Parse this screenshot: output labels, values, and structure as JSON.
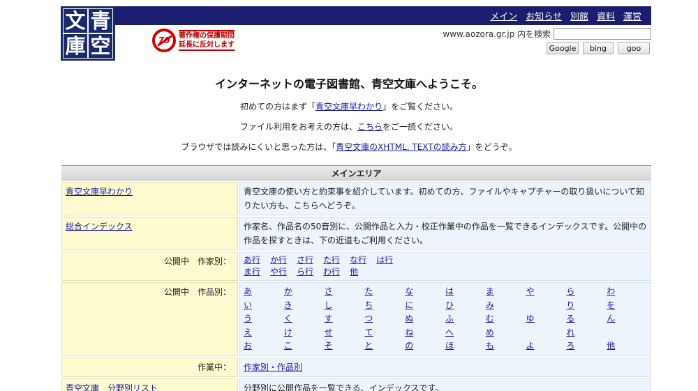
{
  "logo": {
    "chars": [
      "文",
      "青",
      "庫",
      "空"
    ]
  },
  "nav": [
    "メイン",
    "お知らせ",
    "別館",
    "資料",
    "運営"
  ],
  "campaign": {
    "badge": "70",
    "line1": "著作権の保護期間",
    "line2": "延長に反対します"
  },
  "search": {
    "label": "www.aozora.gr.jp 内を検索",
    "value": "",
    "buttons": [
      "Google",
      "bing",
      "goo"
    ]
  },
  "headline": "インターネットの電子図書館、青空文庫へようこそ。",
  "intro": [
    {
      "pre": "初めての方はまず「",
      "link": "青空文庫早わかり",
      "post": "」をご覧ください。"
    },
    {
      "pre": "ファイル利用をお考えの方は、",
      "link": "こちら",
      "post": "をご一読ください。"
    },
    {
      "pre": "ブラウザでは読みにくいと思った方は、「",
      "link": "青空文庫のXHTML, TEXTの読み方",
      "post": "」をどうぞ。"
    }
  ],
  "main": {
    "header": "メインエリア",
    "quick": {
      "link": "青空文庫早わかり",
      "desc": "青空文庫の使い方と約束事を紹介しています。初めての方、ファイルやキャプチャーの取り扱いについて知りたい方も、こちらへどうぞ。"
    },
    "index": {
      "link": "総合インデックス",
      "desc": "作家名、作品名の50音別に、公開作品と入力・校正作業中の作品を一覧できるインデックスです。公開中の作品を探すときは、下の近道もご利用ください。"
    },
    "authors_label": "公開中　作家別：",
    "authors_row1": [
      "あ行",
      "か行",
      "さ行",
      "た行",
      "な行",
      "は行"
    ],
    "authors_row2": [
      "ま行",
      "や行",
      "ら行",
      "わ行",
      "他"
    ],
    "works_label": "公開中　作品別：",
    "works_grid": [
      [
        "あ",
        "か",
        "さ",
        "た",
        "な",
        "は",
        "ま",
        "や",
        "ら",
        "わ"
      ],
      [
        "い",
        "き",
        "し",
        "ち",
        "に",
        "ひ",
        "み",
        "",
        "り",
        "を"
      ],
      [
        "う",
        "く",
        "す",
        "つ",
        "ぬ",
        "ふ",
        "む",
        "ゆ",
        "る",
        "ん"
      ],
      [
        "え",
        "け",
        "せ",
        "て",
        "ね",
        "へ",
        "め",
        "",
        "れ",
        ""
      ],
      [
        "お",
        "こ",
        "そ",
        "と",
        "の",
        "ほ",
        "も",
        "よ",
        "ろ",
        "他"
      ]
    ],
    "wip_label": "作業中：",
    "wip_link": "作家別・作品別",
    "genre": {
      "link": "青空文庫　分野別リスト",
      "desc": "分野別に公開作品を一覧できる、インデックスです。"
    }
  }
}
